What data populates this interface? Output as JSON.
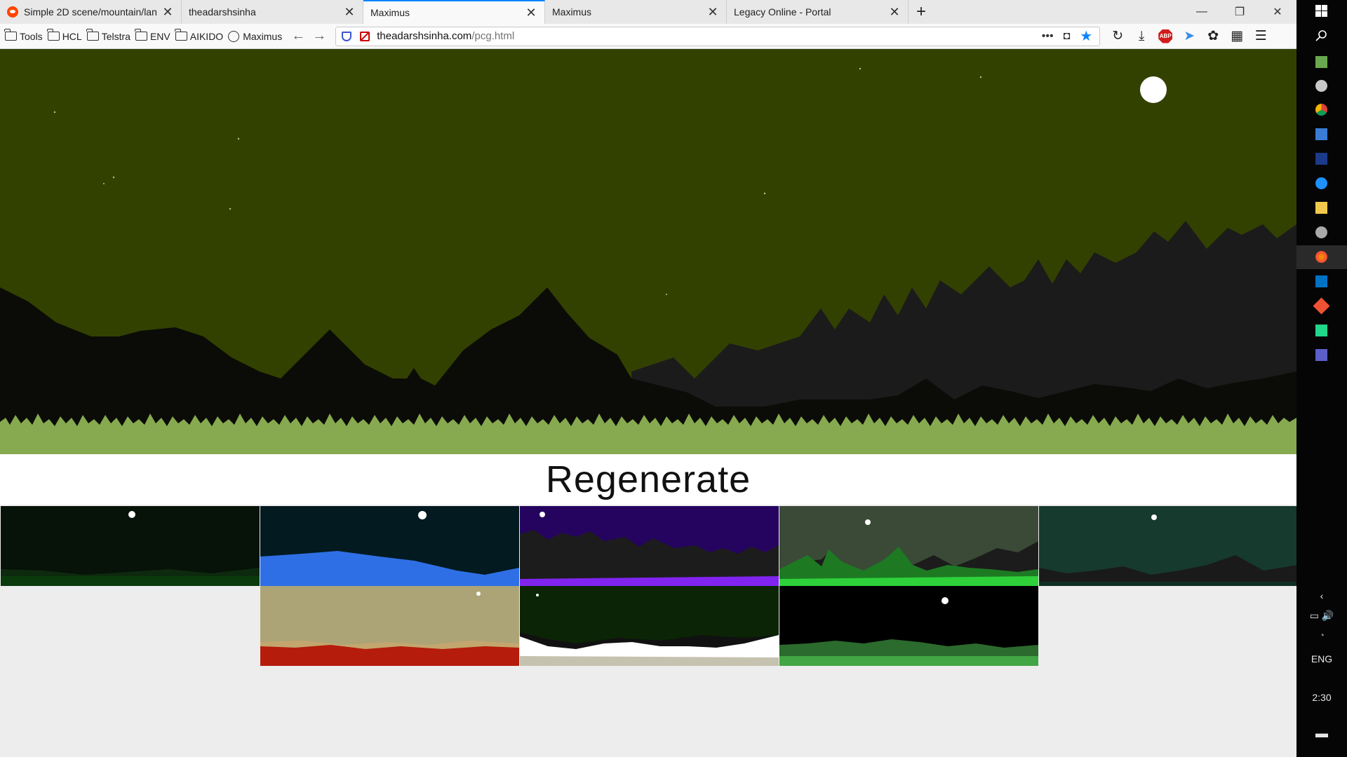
{
  "browser": {
    "tabs": [
      {
        "title": "Simple 2D scene/mountain/lan",
        "active": false,
        "favicon": "reddit-icon"
      },
      {
        "title": "theadarshsinha",
        "active": false
      },
      {
        "title": "Maximus",
        "active": true
      },
      {
        "title": "Maximus",
        "active": false
      },
      {
        "title": "Legacy Online - Portal",
        "active": false
      }
    ],
    "bookmarks": [
      "Tools",
      "HCL",
      "Telstra",
      "ENV",
      "AIKIDO",
      "Maximus"
    ],
    "url": {
      "domain": "theadarshsinha.com",
      "path": "/pcg.html"
    },
    "accent": "#0a84ff"
  },
  "page": {
    "regenerate_label": "Regenerate",
    "hero": {
      "sky": "#334100",
      "mountains_far": "#1b1b1b",
      "mountains_near": "#0b0c08",
      "grass": "#87aa50",
      "moon": "#ffffff"
    },
    "thumbnails": [
      {
        "sky": "#071208",
        "mountain": "#0d2a0e",
        "ground": "#0b3a0c"
      },
      {
        "sky": "#021a20",
        "mountain": "#2f6fe6",
        "ground": "#2a62d8"
      },
      {
        "sky": "#25045f",
        "mountain": "#1c1c1c",
        "ground": "#8124f0"
      },
      {
        "sky": "#3a4a36",
        "mountain": "#1d7a22",
        "ground": "#2ed13a"
      },
      {
        "sky": "#163a2d",
        "mountain": "#1a1a1a",
        "ground": "#0f2f24"
      },
      {
        "sky": "#aca476",
        "mountain": "#c3a66e",
        "ground": "#b51c0b"
      },
      {
        "sky": "#0b2406",
        "mountain": "#111111",
        "ground": "#ffffff"
      },
      {
        "sky": "#000000",
        "mountain": "#2b6b2d",
        "ground": "#43a644"
      }
    ]
  },
  "taskbar": {
    "language": "ENG",
    "time": "2:30"
  }
}
